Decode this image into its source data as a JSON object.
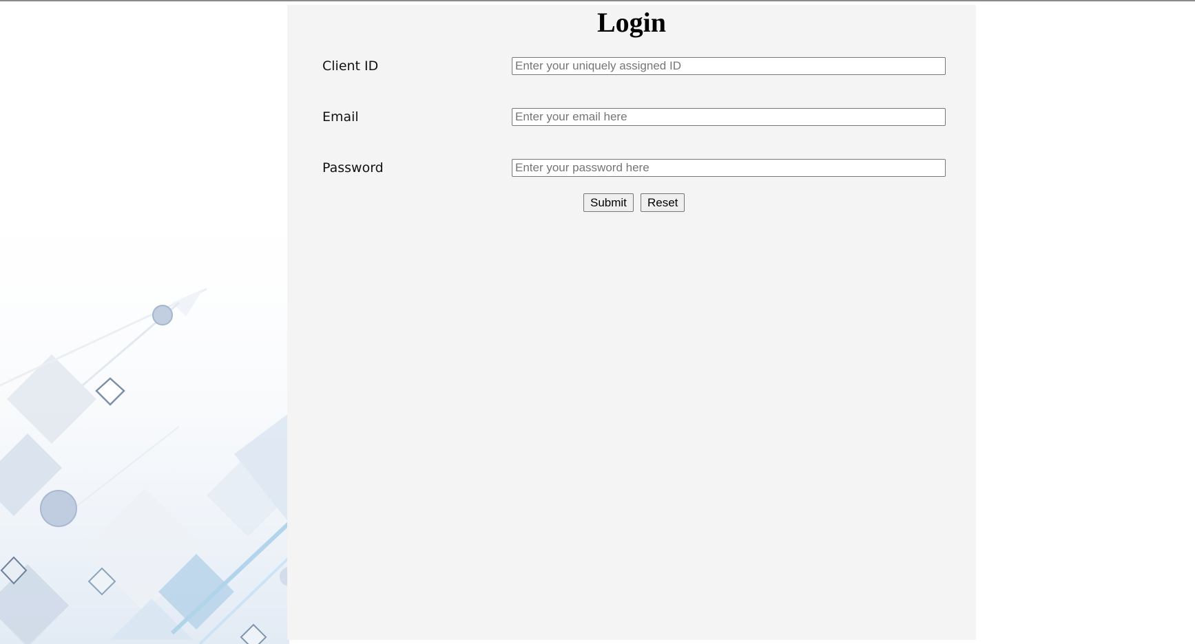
{
  "page": {
    "title": "Login"
  },
  "form": {
    "client_id": {
      "label": "Client ID",
      "value": "",
      "placeholder": "Enter your uniquely assigned ID"
    },
    "email": {
      "label": "Email",
      "value": "",
      "placeholder": "Enter your email here"
    },
    "password": {
      "label": "Password",
      "value": "",
      "placeholder": "Enter your password here"
    },
    "submit_label": "Submit",
    "reset_label": "Reset"
  },
  "colors": {
    "panel_background": "#f4f4f4",
    "page_background": "#ffffff",
    "art_accent": "#9fb6d2"
  }
}
